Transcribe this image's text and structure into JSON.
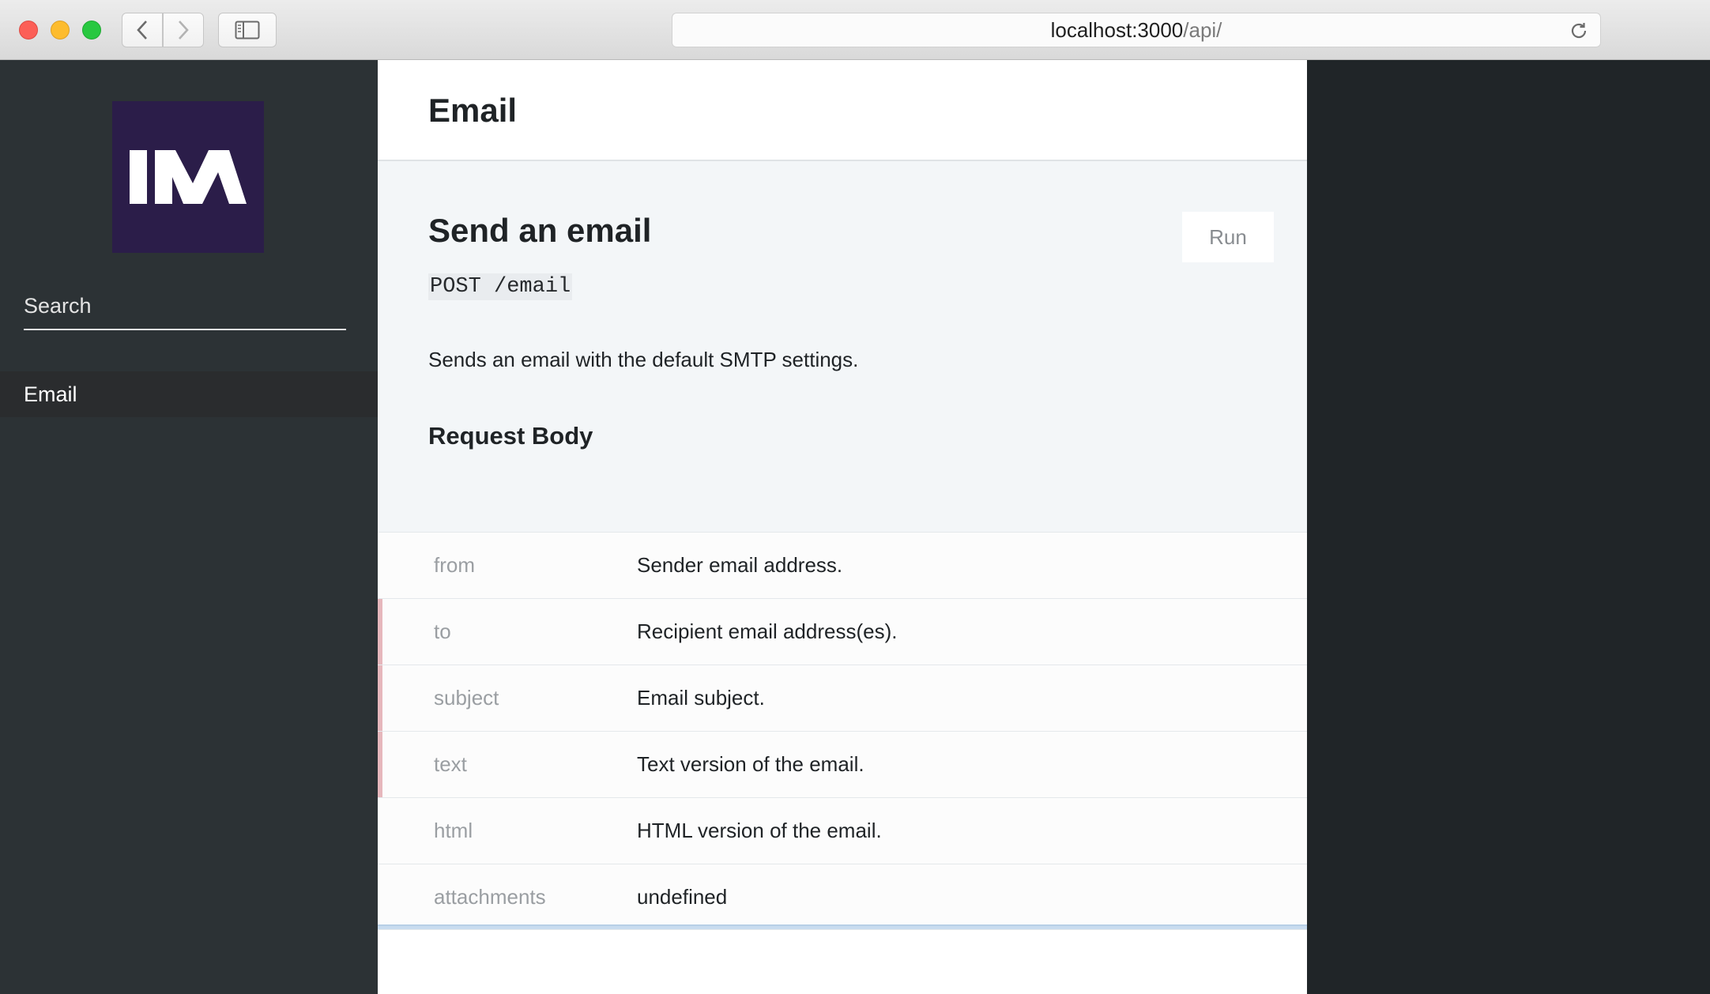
{
  "browser": {
    "url_host": "localhost:3000",
    "url_path": "/api/"
  },
  "sidebar": {
    "logo_text": "IM",
    "search_placeholder": "Search",
    "items": [
      {
        "label": "Email"
      }
    ]
  },
  "header": {
    "title": "Email"
  },
  "endpoint": {
    "title": "Send an email",
    "run_label": "Run",
    "route": "POST /email",
    "description": "Sends an email with the default SMTP settings.",
    "section_title": "Request Body",
    "params": [
      {
        "name": "from",
        "description": "Sender email address.",
        "required": false
      },
      {
        "name": "to",
        "description": "Recipient email address(es).",
        "required": true
      },
      {
        "name": "subject",
        "description": "Email subject.",
        "required": true
      },
      {
        "name": "text",
        "description": "Text version of the email.",
        "required": true
      },
      {
        "name": "html",
        "description": "HTML version of the email.",
        "required": false
      },
      {
        "name": "attachments",
        "description": "undefined",
        "required": false
      }
    ]
  },
  "colors": {
    "sidebar_bg": "#2c3235",
    "logo_bg": "#2b1d49",
    "endpoint_bg": "#f3f6f8",
    "required_marker": "#e6b7bc",
    "right_panel_bg": "#202528"
  }
}
